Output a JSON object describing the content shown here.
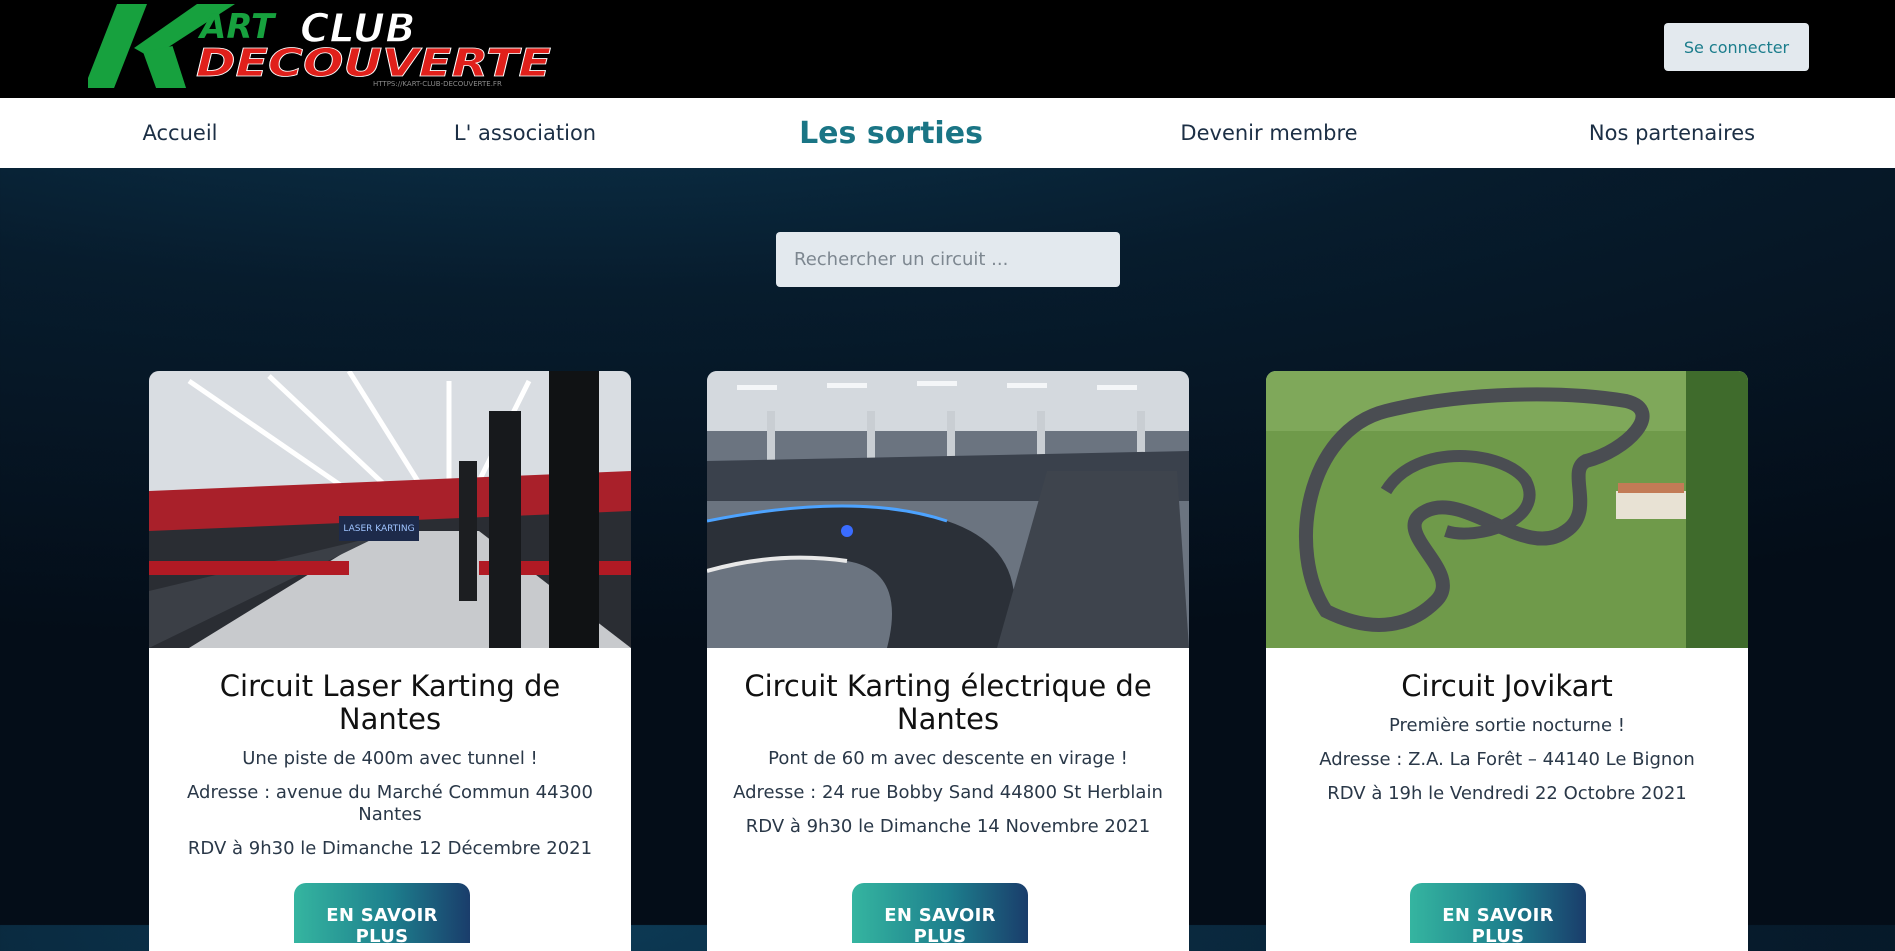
{
  "header": {
    "logo": {
      "line1_part1": "ART",
      "line1_part2": "CLUB",
      "line2": "DECOUVERTE",
      "initial": "K",
      "url": "HTTPS://KART-CLUB-DECOUVERTE.FR"
    },
    "connect_label": "Se connecter"
  },
  "nav": {
    "items": [
      {
        "label": "Accueil"
      },
      {
        "label": "L' association"
      },
      {
        "label": "Les sorties",
        "active": true
      },
      {
        "label": "Devenir membre"
      },
      {
        "label": "Nos partenaires"
      }
    ]
  },
  "search": {
    "placeholder": "Rechercher un circuit ..."
  },
  "cards": [
    {
      "title": "Circuit Laser Karting de Nantes",
      "description": "Une piste de 400m avec tunnel !",
      "address": "Adresse : avenue du Marché Commun 44300 Nantes",
      "rdv": "RDV à 9h30 le Dimanche 12 Décembre 2021",
      "button": "EN SAVOIR PLUS",
      "image": "indoor-laser-karting-track"
    },
    {
      "title": "Circuit Karting électrique de Nantes",
      "description": "Pont de 60 m avec descente en virage !",
      "address": "Adresse : 24 rue Bobby Sand 44800 St Herblain",
      "rdv": "RDV à 9h30 le Dimanche 14 Novembre 2021",
      "button": "EN SAVOIR PLUS",
      "image": "indoor-electric-karting-track"
    },
    {
      "title": "Circuit Jovikart",
      "description": "Première sortie nocturne !",
      "address": "Adresse : Z.A. La Forêt – 44140 Le Bignon",
      "rdv": "RDV à 19h le Vendredi 22 Octobre 2021",
      "button": "EN SAVOIR PLUS",
      "image": "outdoor-aerial-karting-track"
    }
  ],
  "colors": {
    "accent": "#1a7585",
    "nav_text": "#1c2f45",
    "logo_green": "#17a13e",
    "logo_red": "#e0201b"
  }
}
